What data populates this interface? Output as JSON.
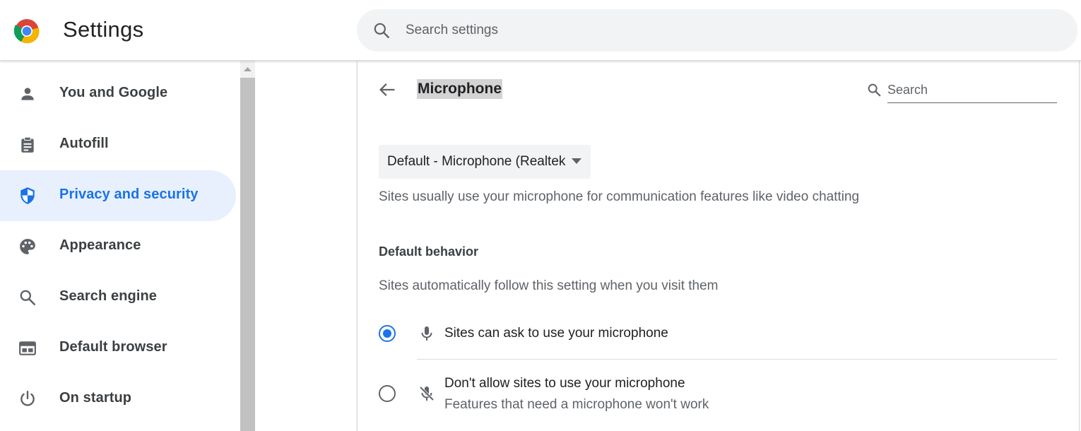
{
  "header": {
    "title": "Settings",
    "search_placeholder": "Search settings"
  },
  "sidebar": {
    "items": [
      {
        "label": "You and Google",
        "icon": "person-icon"
      },
      {
        "label": "Autofill",
        "icon": "clipboard-icon"
      },
      {
        "label": "Privacy and security",
        "icon": "shield-icon",
        "active": true
      },
      {
        "label": "Appearance",
        "icon": "palette-icon"
      },
      {
        "label": "Search engine",
        "icon": "search-icon"
      },
      {
        "label": "Default browser",
        "icon": "browser-window-icon"
      },
      {
        "label": "On startup",
        "icon": "power-icon"
      }
    ]
  },
  "main": {
    "title": "Microphone",
    "search_placeholder": "Search",
    "device_select": "Default - Microphone (Realtek",
    "description": "Sites usually use your microphone for communication features like video chatting",
    "default_behavior": {
      "title": "Default behavior",
      "description": "Sites automatically follow this setting when you visit them",
      "options": [
        {
          "label": "Sites can ask to use your microphone",
          "sublabel": "",
          "checked": true,
          "icon": "microphone-icon"
        },
        {
          "label": "Don't allow sites to use your microphone",
          "sublabel": "Features that need a microphone won't work",
          "checked": false,
          "icon": "microphone-off-icon"
        }
      ]
    }
  },
  "colors": {
    "accent": "#1a73e8",
    "active_bg": "#e8f0fe",
    "text_secondary": "#5f6368"
  }
}
